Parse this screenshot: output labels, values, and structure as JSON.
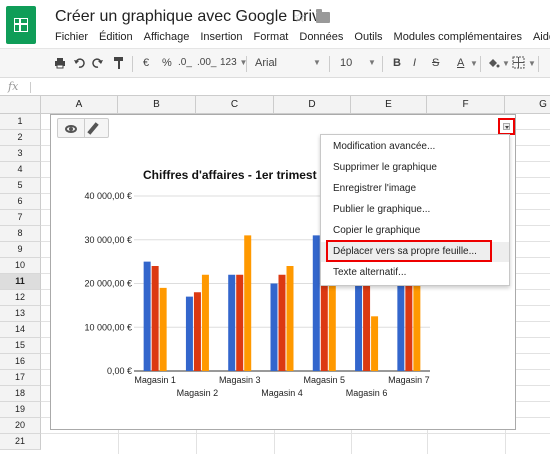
{
  "app": {
    "doc_title": "Créer un graphique avec Google Drive",
    "star_icon": "star-icon",
    "folder_icon": "folder-icon"
  },
  "menubar": {
    "items": [
      "Fichier",
      "Édition",
      "Affichage",
      "Insertion",
      "Format",
      "Données",
      "Outils",
      "Modules complémentaires",
      "Aide"
    ]
  },
  "toolbar": {
    "currency": "€",
    "percent": "%",
    "decimal_less": ".0_",
    "decimal_more": ".00_",
    "number_format": "123",
    "font": "Arial",
    "font_size": "10",
    "bold": "B",
    "italic": "I",
    "strike": "S",
    "text_color": "A"
  },
  "formula_bar": {
    "fx_label": "fx",
    "value": ""
  },
  "sheet": {
    "columns": [
      "A",
      "B",
      "C",
      "D",
      "E",
      "F",
      "G"
    ],
    "rows": [
      "1",
      "2",
      "3",
      "4",
      "5",
      "6",
      "7",
      "8",
      "9",
      "10",
      "11",
      "12",
      "13",
      "14",
      "15",
      "16",
      "17",
      "18",
      "19",
      "20",
      "21"
    ],
    "selected_row": "11"
  },
  "chart_data": {
    "type": "bar",
    "title": "Chiffres d'affaires - 1er trimest",
    "categories": [
      "Magasin 1",
      "Magasin 2",
      "Magasin 3",
      "Magasin 4",
      "Magasin 5",
      "Magasin 6",
      "Magasin 7"
    ],
    "series": [
      {
        "color": "#3366cc",
        "values": [
          25000,
          17000,
          22000,
          20000,
          31000,
          29000,
          28000
        ]
      },
      {
        "color": "#dc3912",
        "values": [
          24000,
          18000,
          22000,
          22000,
          27000,
          26000,
          27000
        ]
      },
      {
        "color": "#ff9900",
        "values": [
          19000,
          22000,
          31000,
          24000,
          23000,
          12500,
          24000
        ]
      }
    ],
    "ylim": [
      0,
      40000
    ],
    "yticks": [
      "0,00 €",
      "10 000,00 €",
      "20 000,00 €",
      "30 000,00 €",
      "40 000,00 €"
    ],
    "grid": true
  },
  "chart_controls": {
    "view_icon": "eye-icon",
    "edit_icon": "pencil-icon",
    "menu_icon": "chevron-down-icon"
  },
  "chart_menu": {
    "items": [
      "Modification avancée...",
      "Supprimer le graphique",
      "Enregistrer l'image",
      "Publier le graphique...",
      "Copier le graphique",
      "Déplacer vers sa propre feuille...",
      "Texte alternatif..."
    ],
    "highlighted_index": 5
  }
}
